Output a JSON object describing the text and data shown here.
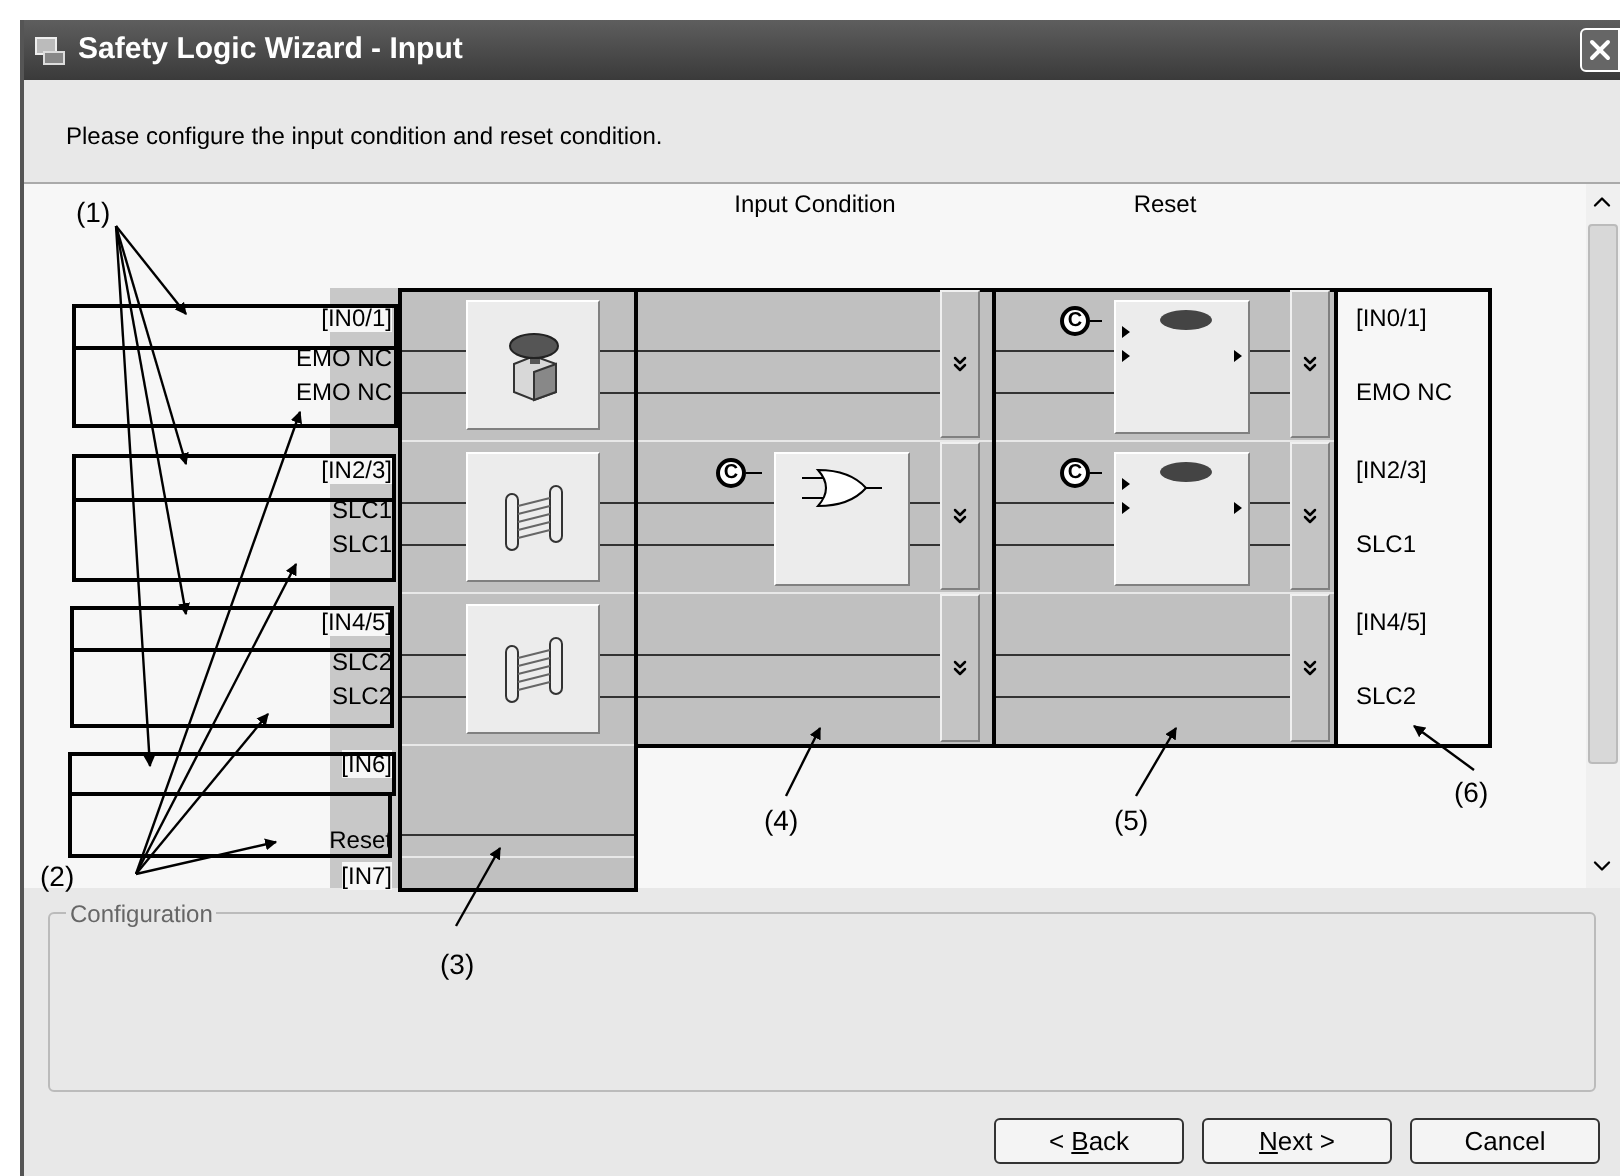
{
  "window": {
    "title": "Safety Logic Wizard - Input"
  },
  "instruction": "Please configure the input condition and reset condition.",
  "headers": {
    "input_condition": "Input Condition",
    "reset": "Reset"
  },
  "rows": [
    {
      "tag": "[IN0/1]",
      "signals": [
        "EMO NC",
        "EMO NC"
      ],
      "device": {
        "kind": "emergency_stop"
      },
      "condition": {
        "kind": "none"
      },
      "reset": {
        "kind": "button",
        "marker": "C"
      },
      "right_tag": "[IN0/1]",
      "right_signal": "EMO NC"
    },
    {
      "tag": "[IN2/3]",
      "signals": [
        "SLC1",
        "SLC1"
      ],
      "device": {
        "kind": "light_curtain"
      },
      "condition": {
        "kind": "or_gate",
        "marker": "C"
      },
      "reset": {
        "kind": "button",
        "marker": "C"
      },
      "right_tag": "[IN2/3]",
      "right_signal": "SLC1"
    },
    {
      "tag": "[IN4/5]",
      "signals": [
        "SLC2",
        "SLC2"
      ],
      "device": {
        "kind": "light_curtain"
      },
      "condition": {
        "kind": "none"
      },
      "reset": {
        "kind": "none"
      },
      "right_tag": "[IN4/5]",
      "right_signal": "SLC2"
    }
  ],
  "extra_rows": [
    {
      "tag": "[IN6]",
      "signal": "Reset"
    },
    {
      "tag": "[IN7]"
    }
  ],
  "configuration": {
    "title": "Configuration"
  },
  "buttons": [
    {
      "parts": [
        {
          "text": "< ",
          "underline": false
        },
        {
          "text": "B",
          "underline": true
        },
        {
          "text": "ack",
          "underline": false
        }
      ]
    },
    {
      "parts": [
        {
          "text": "N",
          "underline": true
        },
        {
          "text": "ext >",
          "underline": false
        }
      ]
    },
    {
      "parts": [
        {
          "text": "Cancel",
          "underline": false
        }
      ]
    }
  ],
  "callouts": [
    {
      "label": "(1)"
    },
    {
      "label": "(2)"
    },
    {
      "label": "(3)"
    },
    {
      "label": "(4)"
    },
    {
      "label": "(5)"
    },
    {
      "label": "(6)"
    }
  ]
}
